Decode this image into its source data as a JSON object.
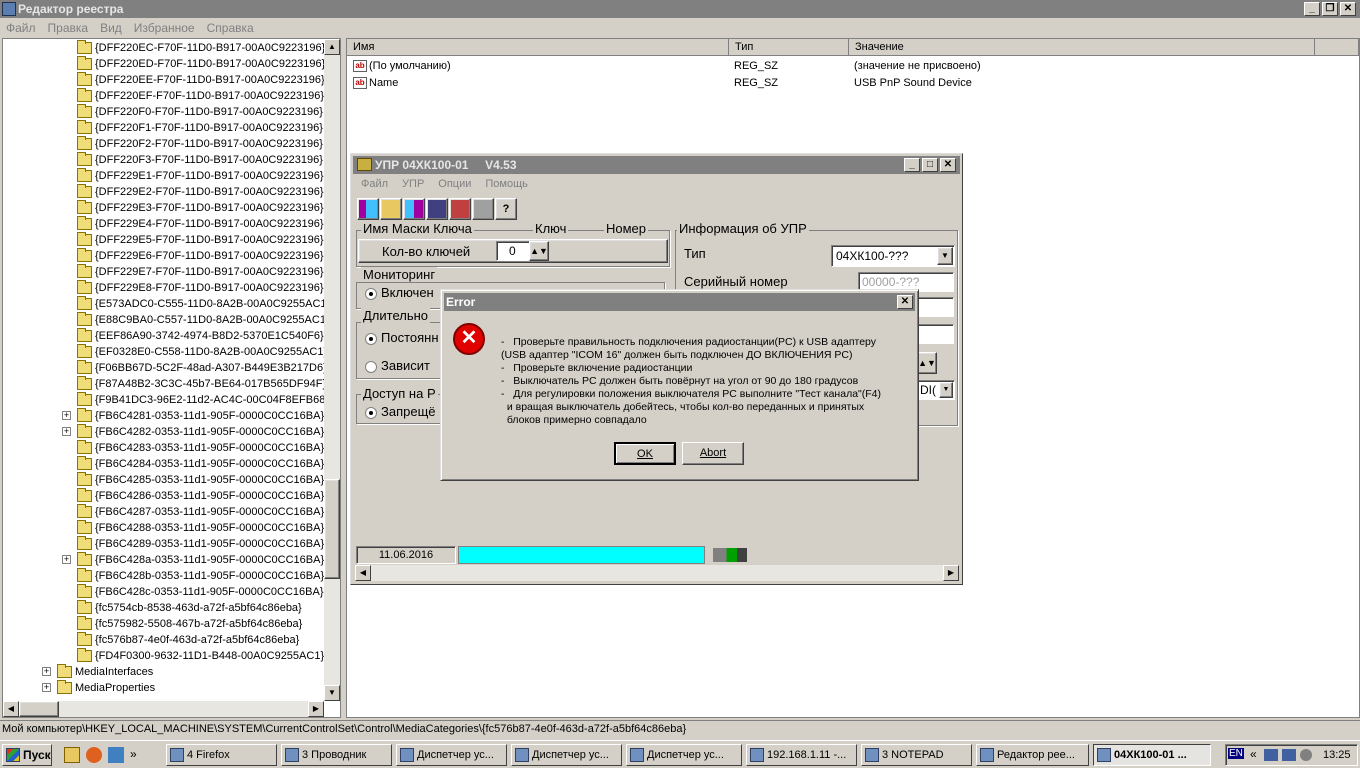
{
  "main_window": {
    "title": "Редактор реестра",
    "menu": [
      "Файл",
      "Правка",
      "Вид",
      "Избранное",
      "Справка"
    ]
  },
  "tree": {
    "items": [
      {
        "label": "{DFF220EC-F70F-11D0-B917-00A0C9223196}",
        "expander": ""
      },
      {
        "label": "{DFF220ED-F70F-11D0-B917-00A0C9223196}",
        "expander": ""
      },
      {
        "label": "{DFF220EE-F70F-11D0-B917-00A0C9223196}",
        "expander": ""
      },
      {
        "label": "{DFF220EF-F70F-11D0-B917-00A0C9223196}",
        "expander": ""
      },
      {
        "label": "{DFF220F0-F70F-11D0-B917-00A0C9223196}",
        "expander": ""
      },
      {
        "label": "{DFF220F1-F70F-11D0-B917-00A0C9223196}",
        "expander": ""
      },
      {
        "label": "{DFF220F2-F70F-11D0-B917-00A0C9223196}",
        "expander": ""
      },
      {
        "label": "{DFF220F3-F70F-11D0-B917-00A0C9223196}",
        "expander": ""
      },
      {
        "label": "{DFF229E1-F70F-11D0-B917-00A0C9223196}",
        "expander": ""
      },
      {
        "label": "{DFF229E2-F70F-11D0-B917-00A0C9223196}",
        "expander": ""
      },
      {
        "label": "{DFF229E3-F70F-11D0-B917-00A0C9223196}",
        "expander": ""
      },
      {
        "label": "{DFF229E4-F70F-11D0-B917-00A0C9223196}",
        "expander": ""
      },
      {
        "label": "{DFF229E5-F70F-11D0-B917-00A0C9223196}",
        "expander": ""
      },
      {
        "label": "{DFF229E6-F70F-11D0-B917-00A0C9223196}",
        "expander": ""
      },
      {
        "label": "{DFF229E7-F70F-11D0-B917-00A0C9223196}",
        "expander": ""
      },
      {
        "label": "{DFF229E8-F70F-11D0-B917-00A0C9223196}",
        "expander": ""
      },
      {
        "label": "{E573ADC0-C555-11D0-8A2B-00A0C9255AC1}",
        "expander": ""
      },
      {
        "label": "{E88C9BA0-C557-11D0-8A2B-00A0C9255AC1}",
        "expander": ""
      },
      {
        "label": "{EEF86A90-3742-4974-B8D2-5370E1C540F6}",
        "expander": ""
      },
      {
        "label": "{EF0328E0-C558-11D0-8A2B-00A0C9255AC1}",
        "expander": ""
      },
      {
        "label": "{F06BB67D-5C2F-48ad-A307-B449E3B217D6}",
        "expander": ""
      },
      {
        "label": "{F87A48B2-3C3C-45b7-BE64-017B565DF94F}",
        "expander": ""
      },
      {
        "label": "{F9B41DC3-96E2-11d2-AC4C-00C04F8EFB68}",
        "expander": ""
      },
      {
        "label": "{FB6C4281-0353-11d1-905F-0000C0CC16BA}",
        "expander": "+"
      },
      {
        "label": "{FB6C4282-0353-11d1-905F-0000C0CC16BA}",
        "expander": "+"
      },
      {
        "label": "{FB6C4283-0353-11d1-905F-0000C0CC16BA}",
        "expander": ""
      },
      {
        "label": "{FB6C4284-0353-11d1-905F-0000C0CC16BA}",
        "expander": ""
      },
      {
        "label": "{FB6C4285-0353-11d1-905F-0000C0CC16BA}",
        "expander": ""
      },
      {
        "label": "{FB6C4286-0353-11d1-905F-0000C0CC16BA}",
        "expander": ""
      },
      {
        "label": "{FB6C4287-0353-11d1-905F-0000C0CC16BA}",
        "expander": ""
      },
      {
        "label": "{FB6C4288-0353-11d1-905F-0000C0CC16BA}",
        "expander": ""
      },
      {
        "label": "{FB6C4289-0353-11d1-905F-0000C0CC16BA}",
        "expander": ""
      },
      {
        "label": "{FB6C428a-0353-11d1-905F-0000C0CC16BA}",
        "expander": "+"
      },
      {
        "label": "{FB6C428b-0353-11d1-905F-0000C0CC16BA}",
        "expander": ""
      },
      {
        "label": "{FB6C428c-0353-11d1-905F-0000C0CC16BA}",
        "expander": ""
      },
      {
        "label": "{fc5754cb-8538-463d-a72f-a5bf64c86eba}",
        "expander": ""
      },
      {
        "label": "{fc575982-5508-467b-a72f-a5bf64c86eba}",
        "expander": ""
      },
      {
        "label": "{fc576b87-4e0f-463d-a72f-a5bf64c86eba}",
        "expander": ""
      },
      {
        "label": "{FD4F0300-9632-11D1-B448-00A0C9255AC1}",
        "expander": ""
      }
    ],
    "parents": [
      {
        "label": "MediaInterfaces",
        "expander": "+"
      },
      {
        "label": "MediaProperties",
        "expander": "+"
      }
    ]
  },
  "list": {
    "columns": [
      "Имя",
      "Тип",
      "Значение"
    ],
    "rows": [
      {
        "name": "(По умолчанию)",
        "type": "REG_SZ",
        "value": "(значение не присвоено)",
        "icon": "ab"
      },
      {
        "name": "Name",
        "type": "REG_SZ",
        "value": "USB PnP Sound Device",
        "icon": "ab"
      }
    ]
  },
  "statusbar": {
    "path": "Мой компьютер\\HKEY_LOCAL_MACHINE\\SYSTEM\\CurrentControlSet\\Control\\MediaCategories\\{fc576b87-4e0f-463d-a72f-a5bf64c86eba}"
  },
  "upr": {
    "title": "УПР 04ХК100-01     V4.53",
    "menu": [
      "Файл",
      "УПР",
      "Опции",
      "Помощь"
    ],
    "keys_group": {
      "legend": "Имя Маски Ключа",
      "col_key": "Ключ",
      "col_num": "Номер",
      "count_label": "Кол-во ключей",
      "count_value": "0"
    },
    "info_group": {
      "legend": "Информация об УПР",
      "type_label": "Тип",
      "type_value": "04ХК100-???",
      "serial_label": "Серийный номер",
      "serial_value": "00000-???"
    },
    "monitoring": {
      "legend": "Мониторинг",
      "option": "Включен"
    },
    "duration": {
      "legend": "Длительно",
      "opt1": "Постоянн",
      "opt2": "Зависит"
    },
    "access": {
      "legend": "Доступ на Р",
      "option": "Запрещё"
    },
    "date": "11.06.2016",
    "combo2_value": "DI("
  },
  "error": {
    "title": "Error",
    "lines": [
      "-   Проверьте правильность подключения радиостанции(PC) к USB адаптеру",
      "(USB адаптер \"ICOM 16\" должен быть подключен ДО ВКЛЮЧЕНИЯ PC)",
      "-   Проверьте включение радиостанции",
      "-   Выключатель PC должен быть повёрнут на угол от 90 до 180 градусов",
      "-   Для регулировки положения выключателя PC выполните \"Тест канала\"(F4)",
      "  и вращая выключатель добейтесь, чтобы кол-во переданных и принятых",
      "  блоков примерно совпадало"
    ],
    "ok": "OK",
    "abort": "Abort"
  },
  "taskbar": {
    "start": "Пуск",
    "items": [
      {
        "label": "4 Firefox",
        "active": false
      },
      {
        "label": "3 Проводник",
        "active": false
      },
      {
        "label": "Диспетчер ус...",
        "active": false
      },
      {
        "label": "Диспетчер ус...",
        "active": false
      },
      {
        "label": "Диспетчер ус...",
        "active": false
      },
      {
        "label": "192.168.1.11 -...",
        "active": false
      },
      {
        "label": "3 NOTEPAD",
        "active": false
      },
      {
        "label": "Редактор рее...",
        "active": false
      },
      {
        "label": "04ХК100-01 ...",
        "active": true
      }
    ],
    "lang": "EN",
    "clock": "13:25"
  }
}
